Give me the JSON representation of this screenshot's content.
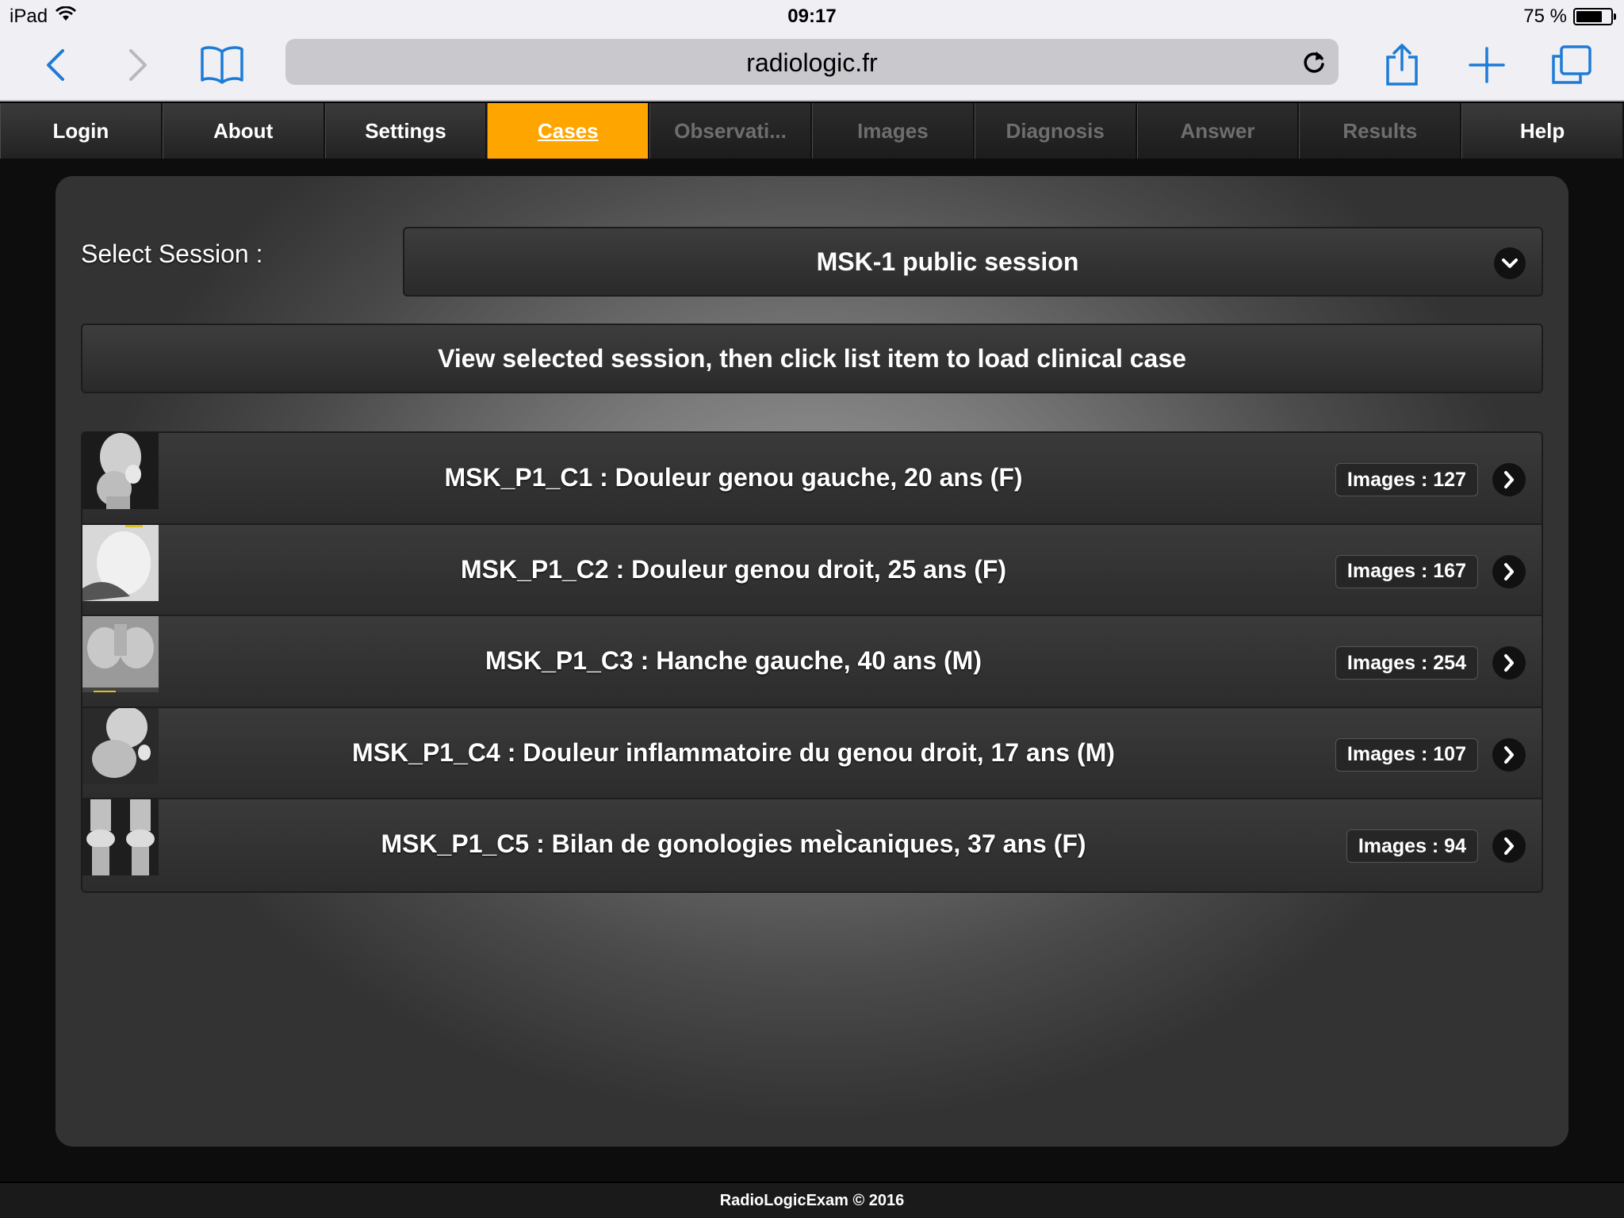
{
  "status_bar": {
    "device": "iPad",
    "time": "09:17",
    "battery": "75 %",
    "battery_level": 0.75
  },
  "browser": {
    "url": "radiologic.fr"
  },
  "tabs": [
    {
      "label": "Login",
      "state": "normal"
    },
    {
      "label": "About",
      "state": "normal"
    },
    {
      "label": "Settings",
      "state": "normal"
    },
    {
      "label": "Cases",
      "state": "active"
    },
    {
      "label": "Observati...",
      "state": "disabled"
    },
    {
      "label": "Images",
      "state": "disabled"
    },
    {
      "label": "Diagnosis",
      "state": "disabled"
    },
    {
      "label": "Answer",
      "state": "disabled"
    },
    {
      "label": "Results",
      "state": "disabled"
    },
    {
      "label": "Help",
      "state": "normal"
    }
  ],
  "session": {
    "label": "Select Session :",
    "selected": "MSK-1 public session"
  },
  "view_button": "View selected session, then click list item to load clinical case",
  "cases": [
    {
      "title": "MSK_P1_C1 : Douleur genou gauche, 20 ans (F)",
      "images": "Images : 127"
    },
    {
      "title": "MSK_P1_C2 : Douleur genou droit, 25 ans (F)",
      "images": "Images : 167"
    },
    {
      "title": "MSK_P1_C3 : Hanche gauche, 40 ans (M)",
      "images": "Images : 254"
    },
    {
      "title": "MSK_P1_C4 : Douleur inflammatoire du genou droit, 17 ans (M)",
      "images": "Images : 107"
    },
    {
      "title": "MSK_P1_C5 : Bilan de gonologies meÌcaniques, 37 ans (F)",
      "images": "Images : 94"
    }
  ],
  "footer": "RadioLogicExam © 2016",
  "colors": {
    "accent": "#ffa500",
    "ios_blue": "#1d7bd6"
  }
}
